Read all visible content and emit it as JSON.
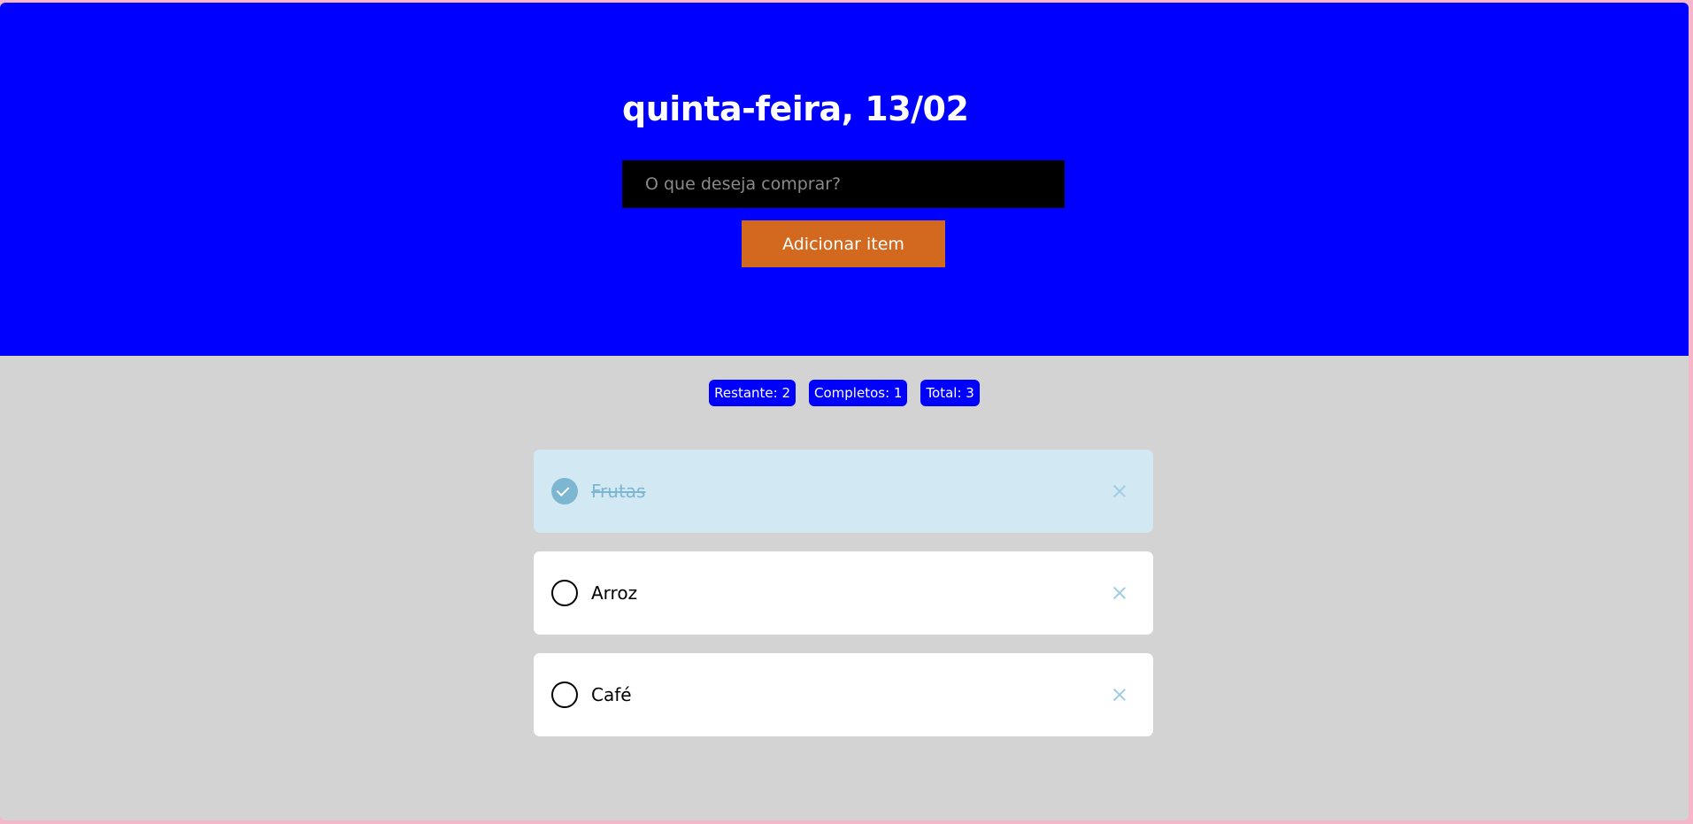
{
  "header": {
    "date_title": "quinta-feira, 13/02",
    "input_placeholder": "O que deseja comprar?",
    "add_button_label": "Adicionar item"
  },
  "stats": {
    "remaining": "Restante: 2",
    "completed": "Completos: 1",
    "total": "Total: 3"
  },
  "items": [
    {
      "label": "Frutas",
      "completed": true
    },
    {
      "label": "Arroz",
      "completed": false
    },
    {
      "label": "Café",
      "completed": false
    }
  ],
  "colors": {
    "hero_background": "#0000ff",
    "page_background": "#d3d3d3",
    "add_button": "#d2691e",
    "badge": "#0000ff",
    "completed_item_background": "#d2e8f3",
    "completed_accent": "#7db6d1"
  },
  "icons": {
    "check": "check-icon",
    "remove": "close-icon"
  }
}
